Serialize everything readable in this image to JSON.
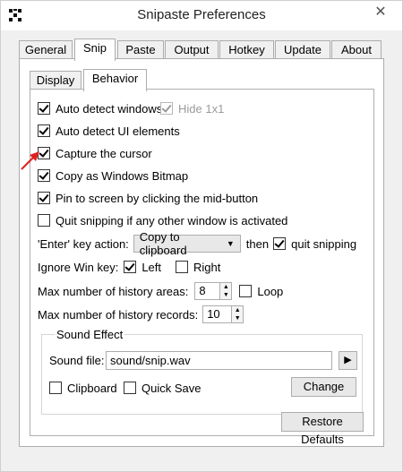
{
  "window": {
    "title": "Snipaste Preferences",
    "close_glyph": "✕"
  },
  "tabs": [
    "General",
    "Snip",
    "Paste",
    "Output",
    "Hotkey",
    "Update",
    "About"
  ],
  "active_tab": "Snip",
  "subtabs": [
    "Display",
    "Behavior"
  ],
  "active_subtab": "Behavior",
  "options": {
    "auto_detect_windows": {
      "label": "Auto detect windows",
      "checked": true
    },
    "hide_1x1": {
      "label": "Hide 1x1",
      "checked": true,
      "disabled": true
    },
    "auto_detect_ui": {
      "label": "Auto detect UI elements",
      "checked": true
    },
    "capture_cursor": {
      "label": "Capture the cursor",
      "checked": true
    },
    "copy_bitmap": {
      "label": "Copy as Windows Bitmap",
      "checked": true
    },
    "pin_mid_button": {
      "label": "Pin to screen by clicking the mid-button",
      "checked": true
    },
    "quit_other_window": {
      "label": "Quit snipping if any other window is activated",
      "checked": false
    }
  },
  "enter_action": {
    "label": "'Enter' key action:",
    "selected": "Copy to clipboard",
    "then_label": "then",
    "quit_label": "quit snipping",
    "quit_checked": true
  },
  "ignore_win": {
    "label": "Ignore Win key:",
    "left_label": "Left",
    "left_checked": true,
    "right_label": "Right",
    "right_checked": false
  },
  "history_areas": {
    "label": "Max number of history areas:",
    "value": "8",
    "loop_label": "Loop",
    "loop_checked": false
  },
  "history_records": {
    "label": "Max number of history records:",
    "value": "10"
  },
  "sound": {
    "group_title": "Sound Effect",
    "file_label": "Sound file:",
    "file_value": "sound/snip.wav",
    "play_glyph": "▶",
    "clipboard_label": "Clipboard",
    "clipboard_checked": false,
    "quicksave_label": "Quick Save",
    "quicksave_checked": false,
    "change_label": "Change"
  },
  "restore_label": "Restore Defaults",
  "accent_arrow_color": "#e02020"
}
